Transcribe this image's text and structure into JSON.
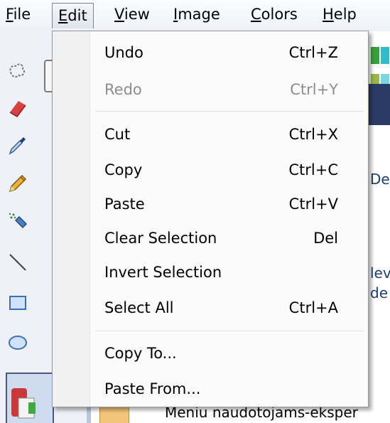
{
  "menubar": {
    "items": [
      {
        "label": "File",
        "mnemonic": "F",
        "rest": "ile"
      },
      {
        "label": "Edit",
        "mnemonic": "E",
        "rest": "dit"
      },
      {
        "label": "View",
        "mnemonic": "V",
        "rest": "iew"
      },
      {
        "label": "Image",
        "mnemonic": "I",
        "rest": "mage"
      },
      {
        "label": "Colors",
        "mnemonic": "C",
        "rest": "olors"
      },
      {
        "label": "Help",
        "mnemonic": "H",
        "rest": "elp"
      }
    ],
    "active": "Edit"
  },
  "edit_menu": {
    "items": [
      {
        "label": "Undo",
        "shortcut": "Ctrl+Z",
        "enabled": true
      },
      {
        "label": "Redo",
        "shortcut": "Ctrl+Y",
        "enabled": false
      },
      {
        "label": "Cut",
        "shortcut": "Ctrl+X",
        "enabled": true
      },
      {
        "label": "Copy",
        "shortcut": "Ctrl+C",
        "enabled": true
      },
      {
        "label": "Paste",
        "shortcut": "Ctrl+V",
        "enabled": true
      },
      {
        "label": "Clear Selection",
        "shortcut": "Del",
        "enabled": true
      },
      {
        "label": "Invert Selection",
        "shortcut": "",
        "enabled": true
      },
      {
        "label": "Select All",
        "shortcut": "Ctrl+A",
        "enabled": true
      },
      {
        "label": "Copy To...",
        "shortcut": "",
        "enabled": true
      },
      {
        "label": "Paste From...",
        "shortcut": "",
        "enabled": true
      }
    ]
  },
  "toolbox": {
    "tools": [
      "free-form-select-icon",
      "eraser-icon",
      "color-picker-icon",
      "pencil-icon",
      "airbrush-icon",
      "line-icon",
      "rectangle-icon",
      "ellipse-icon"
    ]
  },
  "background": {
    "fragments": [
      "De",
      "lev",
      "de"
    ],
    "bottom_text": "Meniu naudotojams-eksper"
  },
  "colors": {
    "menu_bg": "#fbfbfb",
    "gutter": "#f1f1f1",
    "disabled_text": "#8d8d8d",
    "menubar_bg": "#eef2f8",
    "bg_link_text": "#1f3f7a"
  }
}
